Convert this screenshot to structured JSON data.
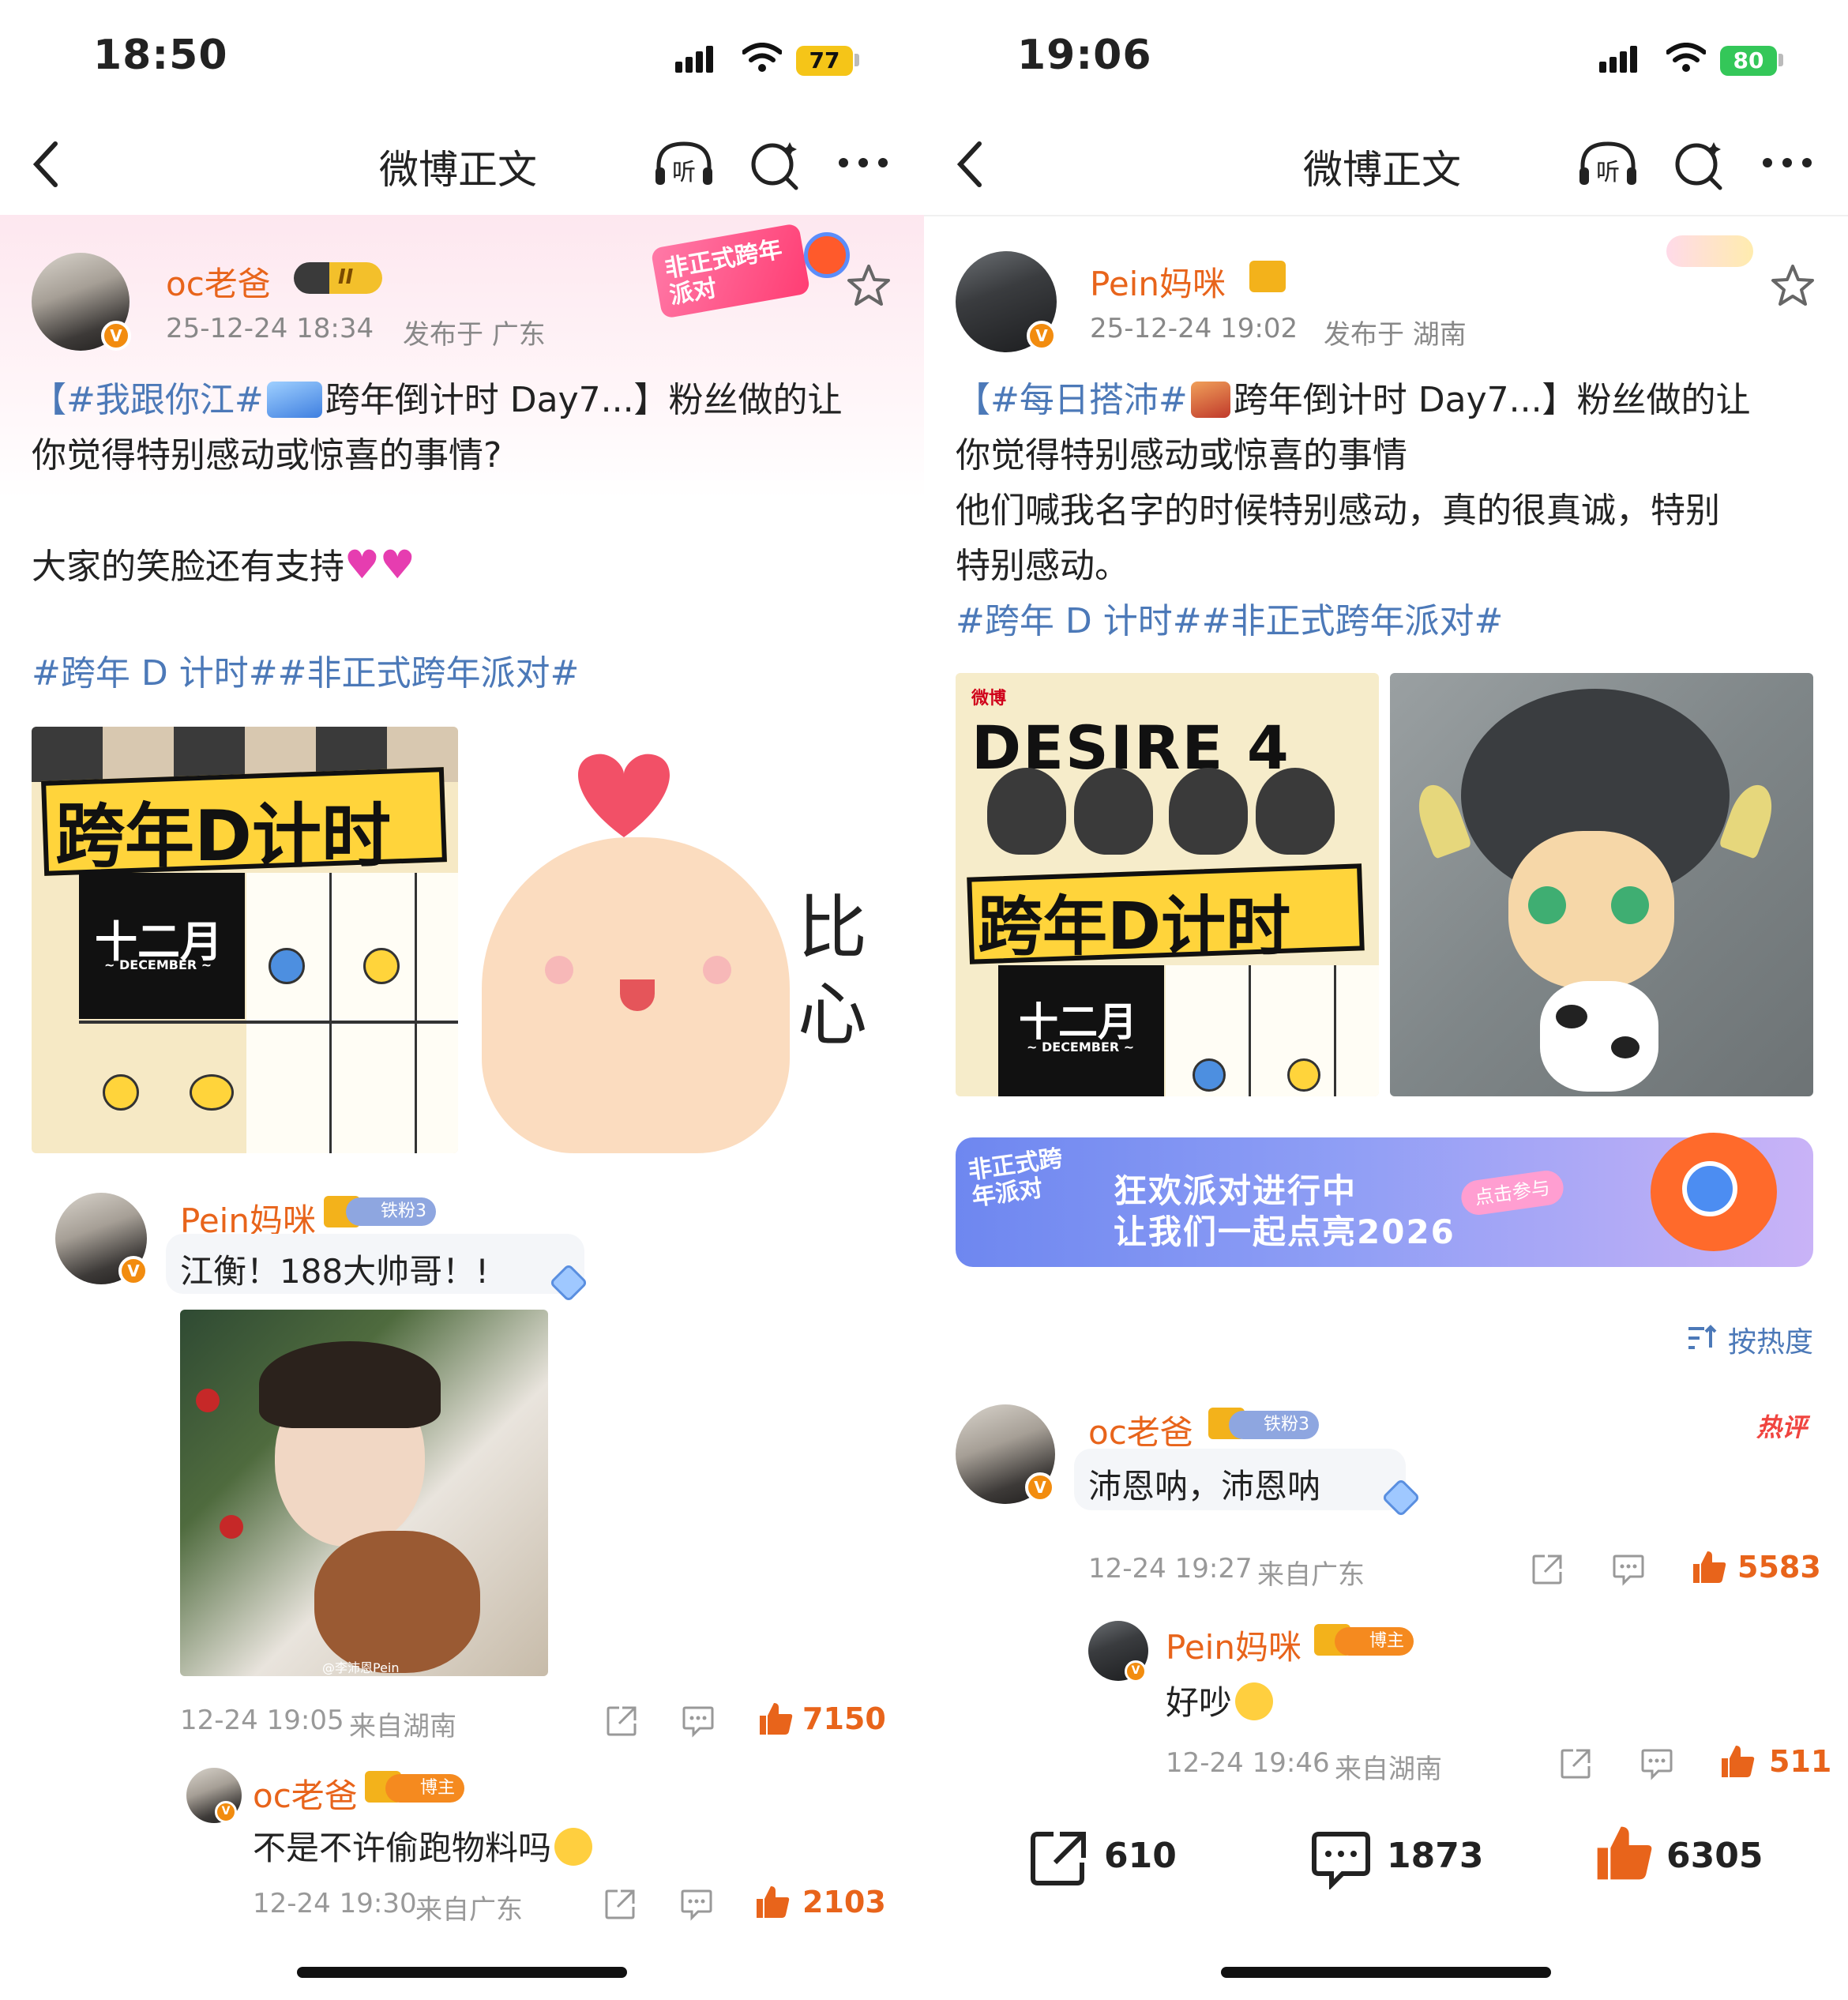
{
  "left": {
    "status": {
      "time": "18:50",
      "battery": "77"
    },
    "nav": {
      "title": "微博正文"
    },
    "post": {
      "author": "oc老爸",
      "badge": "II",
      "timestamp": "25-12-24 18:34",
      "location": "发布于 广东",
      "event_badge": "非正式跨年派对",
      "line1_topic": "【#我跟你江#",
      "line1_rest": "跨年倒计时 Day7...】粉丝做的让",
      "line2": "你觉得特别感动或惊喜的事情?",
      "line3": "大家的笑脸还有支持",
      "hashtags": "#跨年 D 计时##非正式跨年派对#",
      "image1_title": "跨年D计时",
      "image1_month": "十二月",
      "image1_month_en": "~ DECEMBER ~",
      "sticker_text": "比心"
    },
    "comment1": {
      "author": "Pein妈咪",
      "fan_badge": "铁粉3",
      "text": "江衡！188大帅哥！!",
      "image_watermark": "@李沛恩Pein",
      "time": "12-24 19:05",
      "source": "来自湖南",
      "likes": "7150"
    },
    "reply1": {
      "author": "oc老爸",
      "badge": "博主",
      "text": "不是不许偷跑物料吗",
      "time": "12-24 19:30",
      "source": "来自广东",
      "likes": "2103"
    }
  },
  "right": {
    "status": {
      "time": "19:06",
      "battery": "80"
    },
    "nav": {
      "title": "微博正文"
    },
    "post": {
      "author": "Pein妈咪",
      "timestamp": "25-12-24 19:02",
      "location": "发布于 湖南",
      "line1_topic": "【#每日搭沛#",
      "line1_rest": "跨年倒计时 Day7...】粉丝做的让",
      "line2": "你觉得特别感动或惊喜的事情",
      "line3": "他们喊我名字的时候特别感动，真的很真诚，特别",
      "line4": "特别感动。",
      "hashtags": "#跨年 D 计时##非正式跨年派对#",
      "image1_logo": "微博",
      "image1_top": "DESIRE 4",
      "image1_title": "跨年D计时",
      "image1_month": "十二月",
      "image1_month_en": "~ DECEMBER ~"
    },
    "banner": {
      "logo": "非正式跨年派对",
      "line1": "狂欢派对进行中",
      "line2": "让我们一起点亮2026",
      "cta": "点击参与"
    },
    "sort": {
      "label": "按热度"
    },
    "comment1": {
      "author": "oc老爸",
      "fan_badge": "铁粉3",
      "hot": "热评",
      "text": "沛恩呐，沛恩呐",
      "time": "12-24 19:27",
      "source": "来自广东",
      "likes": "5583"
    },
    "reply1": {
      "author": "Pein妈咪",
      "badge": "博主",
      "text": "好吵",
      "time": "12-24 19:46",
      "source": "来自湖南",
      "likes": "511"
    },
    "bottom": {
      "reposts": "610",
      "comments": "1873",
      "likes": "6305"
    }
  },
  "colors": {
    "orange": "#e8641b",
    "topic_blue": "#4c79b8",
    "gray": "#999999",
    "banner": "#5b74e6"
  }
}
